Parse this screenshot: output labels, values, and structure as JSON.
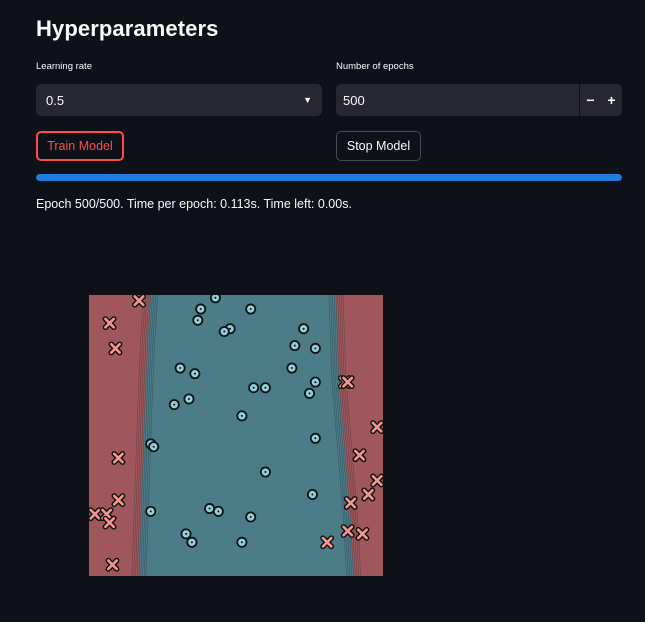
{
  "header": {
    "title": "Hyperparameters"
  },
  "learning_rate": {
    "label": "Learning rate",
    "value": "0.5"
  },
  "epochs": {
    "label": "Number of epochs",
    "value": "500",
    "decrement": "−",
    "increment": "+"
  },
  "buttons": {
    "train": "Train Model",
    "stop": "Stop Model"
  },
  "progress": {
    "fraction": 1.0,
    "color": "#1f7ee0"
  },
  "status_text": "Epoch 500/500. Time per epoch: 0.113s. Time left: 0.00s.",
  "colors": {
    "background": "#0e1117",
    "widget": "#262730",
    "accent_red": "#ff4b4b",
    "region_class_x": "#a0575b",
    "region_class_o": "#4c7c88",
    "marker_x": "#f4978e",
    "marker_o": "#8ecfe0"
  },
  "chart_data": {
    "type": "scatter",
    "title": "",
    "xlabel": "",
    "ylabel": "",
    "xlim": [
      0,
      1
    ],
    "ylim": [
      0,
      1
    ],
    "grid": false,
    "legend": "none",
    "decision_boundary": {
      "left": [
        [
          0.17,
          0.0
        ],
        [
          0.18,
          0.3
        ],
        [
          0.19,
          0.6
        ],
        [
          0.2,
          0.85
        ],
        [
          0.21,
          1.0
        ]
      ],
      "right": [
        [
          0.9,
          0.0
        ],
        [
          0.89,
          0.2
        ],
        [
          0.87,
          0.45
        ],
        [
          0.85,
          0.7
        ],
        [
          0.84,
          1.0
        ]
      ]
    },
    "series": [
      {
        "marker": "x",
        "points": [
          [
            0.17,
            0.98
          ],
          [
            0.07,
            0.9
          ],
          [
            0.09,
            0.81
          ],
          [
            0.1,
            0.42
          ],
          [
            0.1,
            0.27
          ],
          [
            0.02,
            0.22
          ],
          [
            0.06,
            0.22
          ],
          [
            0.07,
            0.19
          ],
          [
            0.08,
            0.04
          ],
          [
            0.87,
            0.69
          ],
          [
            0.88,
            0.69
          ],
          [
            0.98,
            0.53
          ],
          [
            0.92,
            0.43
          ],
          [
            0.98,
            0.34
          ],
          [
            0.95,
            0.29
          ],
          [
            0.89,
            0.26
          ],
          [
            0.88,
            0.16
          ],
          [
            0.93,
            0.15
          ],
          [
            0.81,
            0.12
          ]
        ]
      },
      {
        "marker": "o",
        "points": [
          [
            0.43,
            0.99
          ],
          [
            0.55,
            0.95
          ],
          [
            0.38,
            0.95
          ],
          [
            0.37,
            0.91
          ],
          [
            0.48,
            0.88
          ],
          [
            0.46,
            0.87
          ],
          [
            0.73,
            0.88
          ],
          [
            0.7,
            0.82
          ],
          [
            0.77,
            0.81
          ],
          [
            0.69,
            0.74
          ],
          [
            0.31,
            0.74
          ],
          [
            0.36,
            0.72
          ],
          [
            0.77,
            0.69
          ],
          [
            0.56,
            0.67
          ],
          [
            0.6,
            0.67
          ],
          [
            0.75,
            0.65
          ],
          [
            0.34,
            0.63
          ],
          [
            0.29,
            0.61
          ],
          [
            0.52,
            0.57
          ],
          [
            0.77,
            0.49
          ],
          [
            0.21,
            0.47
          ],
          [
            0.22,
            0.46
          ],
          [
            0.6,
            0.37
          ],
          [
            0.76,
            0.29
          ],
          [
            0.41,
            0.24
          ],
          [
            0.44,
            0.23
          ],
          [
            0.21,
            0.23
          ],
          [
            0.55,
            0.21
          ],
          [
            0.33,
            0.15
          ],
          [
            0.35,
            0.12
          ],
          [
            0.52,
            0.12
          ]
        ]
      }
    ]
  }
}
